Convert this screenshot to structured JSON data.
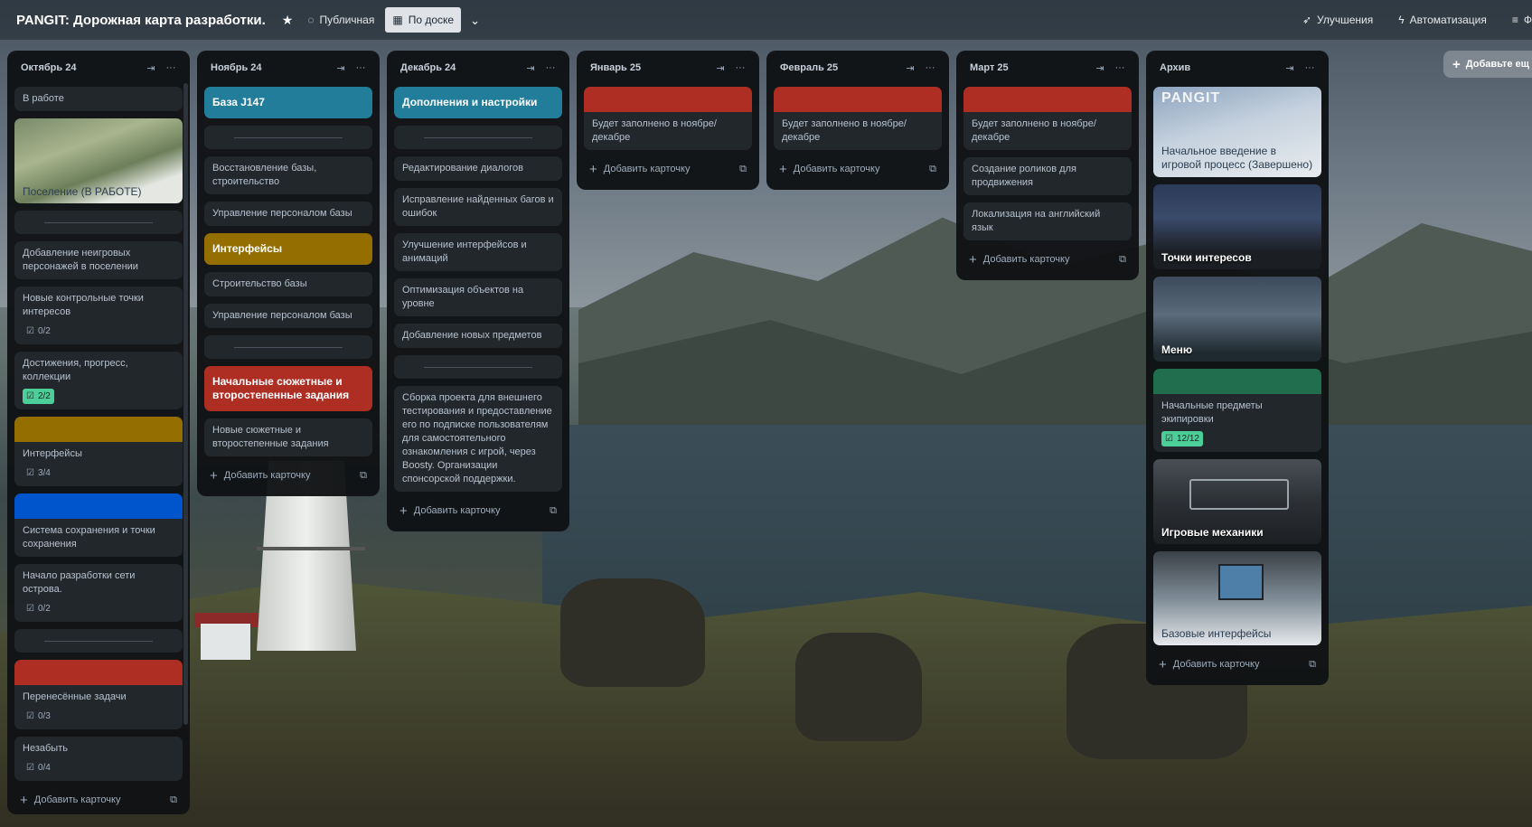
{
  "header": {
    "title": "PANGIT: Дорожная карта разработки.",
    "visibility_label": "Публичная",
    "view_label": "По доске",
    "powerups_label": "Улучшения",
    "automation_label": "Автоматизация",
    "filter_label": "Ф"
  },
  "add_card_label": "Добавить карточку",
  "add_list_label": "Добавьте ещ",
  "lists": {
    "oct": {
      "title": "Октябрь 24",
      "cards": {
        "c0": "В работе",
        "c1": "Поселение (В РАБОТЕ)",
        "c3": "Добавление неигровых персонажей в поселении",
        "c4": "Новые контрольные точки интересов",
        "c4_badge": "0/2",
        "c5": "Достижения, прогресс, коллекции",
        "c5_badge": "2/2",
        "c6": "Интерфейсы",
        "c6_badge": "3/4",
        "c7": "Система сохранения и точки сохранения",
        "c8": "Начало разработки сети острова.",
        "c8_badge": "0/2",
        "c10": "Перенесённые задачи",
        "c10_badge": "0/3",
        "c11": "Незабыть",
        "c11_badge": "0/4"
      }
    },
    "nov": {
      "title": "Ноябрь 24",
      "cards": {
        "c0": "База J147",
        "c2": "Восстановление базы, строительство",
        "c3": "Управление персоналом базы",
        "c4": "Интерфейсы",
        "c5": "Строительство базы",
        "c6": "Управление персоналом базы",
        "c8": "Начальные сюжетные и второстепенные задания",
        "c9": "Новые сюжетные и второстепенные задания"
      }
    },
    "dec": {
      "title": "Декабрь 24",
      "cards": {
        "c0": "Дополнения и настройки",
        "c2": "Редактирование диалогов",
        "c3": "Исправление найденных багов и ошибок",
        "c4": "Улучшение интерфейсов и анимаций",
        "c5": "Оптимизация объектов на уровне",
        "c6": "Добавление новых предметов",
        "c8": "Сборка проекта для внешнего тестирования и предоставление его по подписке пользователям для самостоятельного ознакомления с игрой, через Boosty. Организации спонсорской поддержки."
      }
    },
    "jan": {
      "title": "Январь 25",
      "cards": {
        "c0": "Будет заполнено в ноябре/декабре"
      }
    },
    "feb": {
      "title": "Февраль 25",
      "cards": {
        "c0": "Будет заполнено в ноябре/декабре"
      }
    },
    "mar": {
      "title": "Март 25",
      "cards": {
        "c0": "Будет заполнено в ноябре/декабре",
        "c1": "Создание роликов для продвижения",
        "c2": "Локализация на английский язык"
      }
    },
    "archive": {
      "title": "Архив",
      "cards": {
        "c0_logo": "PANGIT",
        "c0": "Начальное введение в игровой процесс (Завершено)",
        "c1": "Точки интересов",
        "c2": "Меню",
        "c3": "Начальные предметы экипировки",
        "c3_badge": "12/12",
        "c4": "Игровые механики",
        "c5": "Базовые интерфейсы"
      }
    }
  },
  "colors": {
    "teal": "#227d9b",
    "yellow": "#946f00",
    "red": "#ae2e24",
    "blue": "#0055cc",
    "green": "#216e4e"
  }
}
